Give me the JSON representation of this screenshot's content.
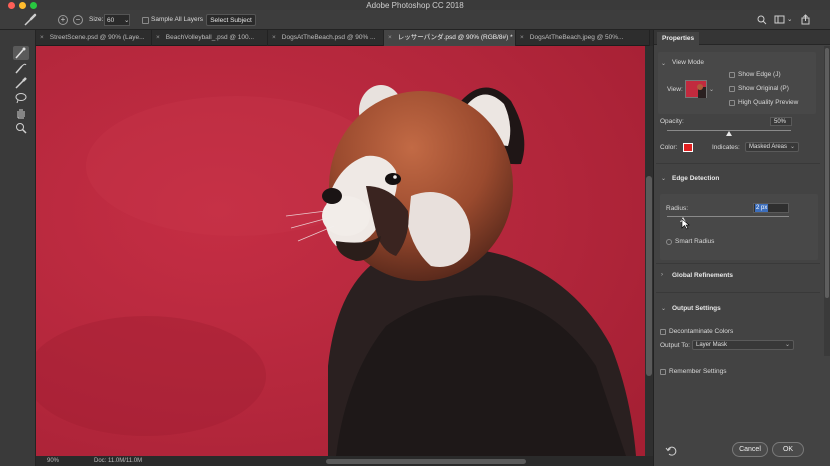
{
  "app": {
    "title": "Adobe Photoshop CC 2018"
  },
  "options": {
    "size_label": "Size:",
    "size_value": "60",
    "sample_all_layers": "Sample All Layers",
    "select_subject": "Select Subject"
  },
  "tabs": [
    {
      "label": "StreetScene.psd @ 90% (Laye..."
    },
    {
      "label": "BeachVolleyball_.psd @ 100..."
    },
    {
      "label": "DogsAtTheBeach.psd @ 90% ..."
    },
    {
      "label": "レッサーパンダ.psd @ 90% (RGB/8#) *"
    },
    {
      "label": "DogsAtTheBeach.jpeg @ 50%..."
    }
  ],
  "status": {
    "zoom": "90%",
    "doc": "Doc: 11.0M/11.0M"
  },
  "properties": {
    "panel_title": "Properties",
    "view_mode": {
      "heading": "View Mode",
      "view_label": "View:",
      "show_edge": "Show Edge (J)",
      "show_original": "Show Original (P)",
      "high_quality_preview": "High Quality Preview"
    },
    "opacity": {
      "label": "Opacity:",
      "value": "50%",
      "level": 0.5
    },
    "color": {
      "label": "Color:",
      "swatch": "#e02020"
    },
    "indicates": {
      "label": "Indicates:",
      "value": "Masked Areas"
    },
    "edge_detection": {
      "heading": "Edge Detection",
      "radius_label": "Radius:",
      "radius_value": "2 px",
      "smart_radius": "Smart Radius"
    },
    "global_refinements": {
      "heading": "Global Refinements"
    },
    "output_settings": {
      "heading": "Output Settings",
      "decontaminate": "Decontaminate Colors",
      "output_to_label": "Output To:",
      "output_to_value": "Layer Mask",
      "remember": "Remember Settings"
    },
    "cancel": "Cancel",
    "ok": "OK"
  },
  "colors": {
    "overlay": "#b8283e",
    "accent": "#3c6ebc"
  }
}
